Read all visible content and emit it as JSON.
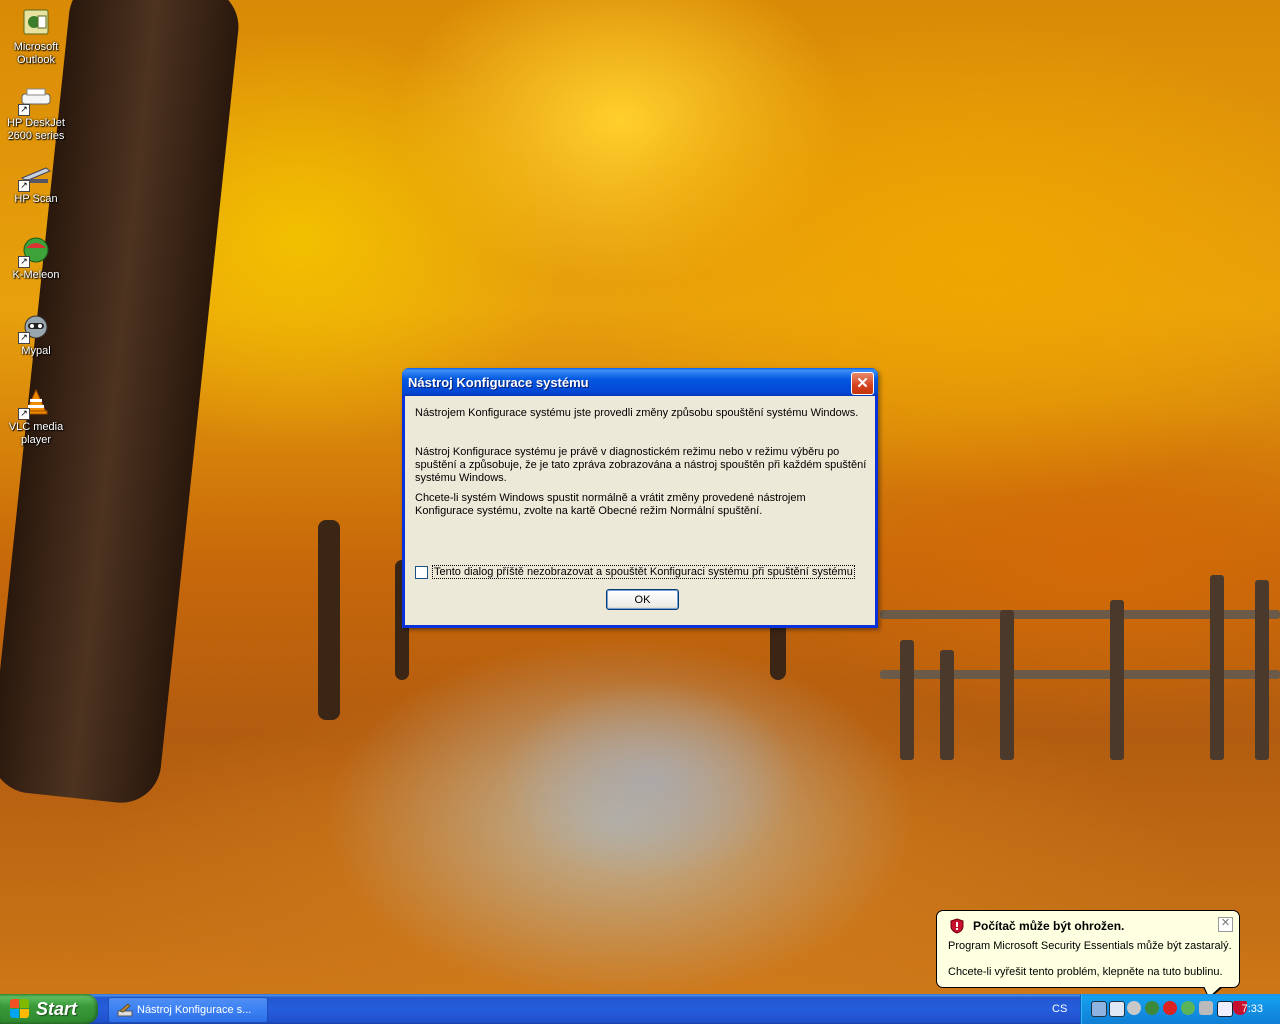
{
  "desktop": {
    "icons": [
      {
        "label": "Microsoft Outlook",
        "icon": "outlook-icon"
      },
      {
        "label": "HP DeskJet 2600 series",
        "icon": "printer-icon"
      },
      {
        "label": "HP Scan",
        "icon": "scanner-icon"
      },
      {
        "label": "K-Meleon",
        "icon": "k-meleon-icon"
      },
      {
        "label": "Mypal",
        "icon": "mypal-icon"
      },
      {
        "label": "VLC media player",
        "icon": "vlc-icon"
      }
    ]
  },
  "dialog": {
    "title": "Nástroj Konfigurace systému",
    "para1": "Nástrojem Konfigurace systému jste provedli změny způsobu spouštění systému Windows.",
    "para2": "Nástroj Konfigurace systému je právě v diagnostickém režimu nebo v režimu výběru po spuštění a způsobuje, že je tato zpráva zobrazována a nástroj spouštěn při každém spuštění systému Windows.",
    "para3": "Chcete-li systém Windows spustit normálně a vrátit změny provedené nástrojem Konfigurace systému, zvolte na kartě Obecné režim Normální spuštění.",
    "checkbox_label": "Tento dialog příště nezobrazovat a spouštět Konfiguraci systému při spuštění systému",
    "checkbox_checked": false,
    "ok_label": "OK"
  },
  "balloon": {
    "title": "Počítač může být ohrožen.",
    "line1": "Program Microsoft Security Essentials může být zastaralý.",
    "line2": "Chcete-li vyřešit tento problém, klepněte na tuto bublinu."
  },
  "taskbar": {
    "start_label": "Start",
    "task_label": "Nástroj Konfigurace s...",
    "language": "CS",
    "clock": "7:33"
  }
}
